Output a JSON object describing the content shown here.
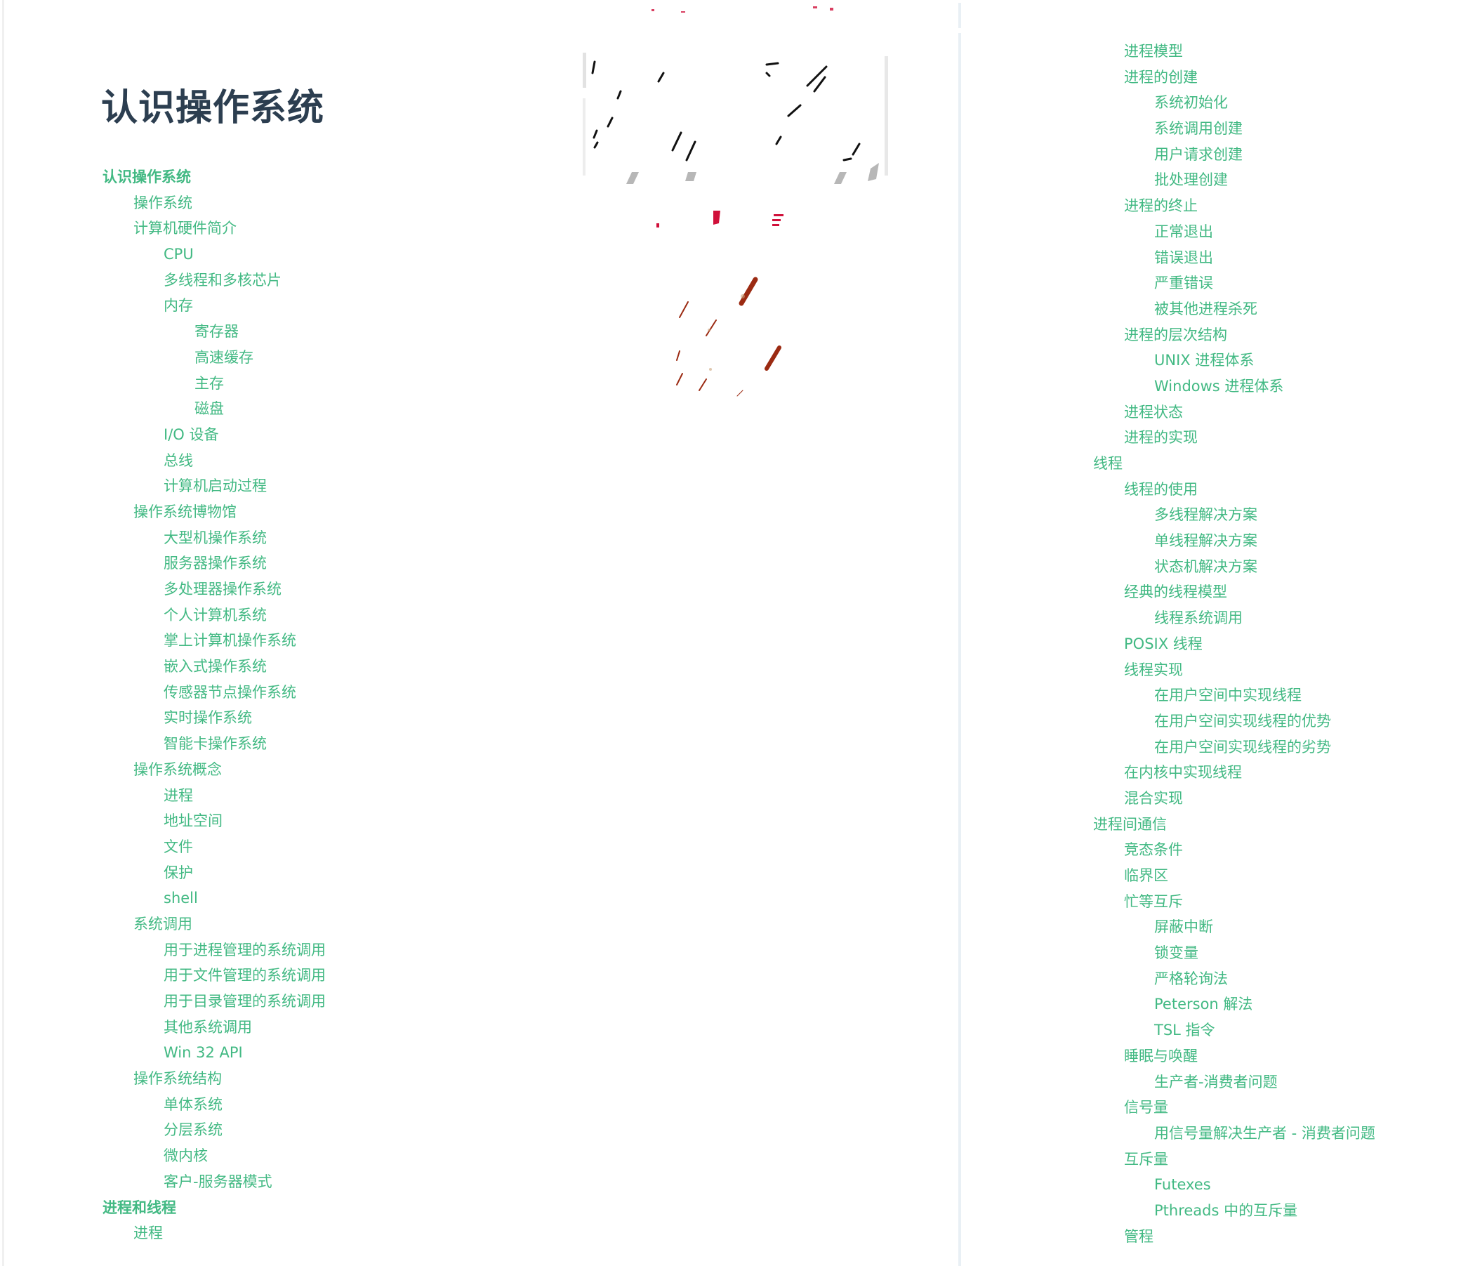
{
  "page": {
    "title": "认识操作系统",
    "link_color": "#42b983",
    "title_color": "#2c3e50"
  },
  "cover_image": {
    "alt": "book cover illustration (faded)"
  },
  "toc_left": [
    {
      "label": "认识操作系统",
      "level": 1,
      "bold": true
    },
    {
      "label": "操作系统",
      "level": 2
    },
    {
      "label": "计算机硬件简介",
      "level": 2
    },
    {
      "label": "CPU",
      "level": 3
    },
    {
      "label": "多线程和多核芯片",
      "level": 3
    },
    {
      "label": "内存",
      "level": 3
    },
    {
      "label": "寄存器",
      "level": 4
    },
    {
      "label": "高速缓存",
      "level": 4
    },
    {
      "label": "主存",
      "level": 4
    },
    {
      "label": "磁盘",
      "level": 4
    },
    {
      "label": "I/O 设备",
      "level": 3
    },
    {
      "label": "总线",
      "level": 3
    },
    {
      "label": "计算机启动过程",
      "level": 3
    },
    {
      "label": "操作系统博物馆",
      "level": 2
    },
    {
      "label": "大型机操作系统",
      "level": 3
    },
    {
      "label": "服务器操作系统",
      "level": 3
    },
    {
      "label": "多处理器操作系统",
      "level": 3
    },
    {
      "label": "个人计算机系统",
      "level": 3
    },
    {
      "label": "掌上计算机操作系统",
      "level": 3
    },
    {
      "label": "嵌入式操作系统",
      "level": 3
    },
    {
      "label": "传感器节点操作系统",
      "level": 3
    },
    {
      "label": "实时操作系统",
      "level": 3
    },
    {
      "label": "智能卡操作系统",
      "level": 3
    },
    {
      "label": "操作系统概念",
      "level": 2
    },
    {
      "label": "进程",
      "level": 3
    },
    {
      "label": "地址空间",
      "level": 3
    },
    {
      "label": "文件",
      "level": 3
    },
    {
      "label": "保护",
      "level": 3
    },
    {
      "label": "shell",
      "level": 3
    },
    {
      "label": "系统调用",
      "level": 2
    },
    {
      "label": "用于进程管理的系统调用",
      "level": 3
    },
    {
      "label": "用于文件管理的系统调用",
      "level": 3
    },
    {
      "label": "用于目录管理的系统调用",
      "level": 3
    },
    {
      "label": "其他系统调用",
      "level": 3
    },
    {
      "label": "Win 32 API",
      "level": 3
    },
    {
      "label": "操作系统结构",
      "level": 2
    },
    {
      "label": "单体系统",
      "level": 3
    },
    {
      "label": "分层系统",
      "level": 3
    },
    {
      "label": "微内核",
      "level": 3
    },
    {
      "label": "客户-服务器模式",
      "level": 3
    },
    {
      "label": "进程和线程",
      "level": 1,
      "bold": true
    },
    {
      "label": "进程",
      "level": 2
    }
  ],
  "toc_right": [
    {
      "label": "进程模型",
      "level": 2
    },
    {
      "label": "进程的创建",
      "level": 2
    },
    {
      "label": "系统初始化",
      "level": 3
    },
    {
      "label": "系统调用创建",
      "level": 3
    },
    {
      "label": "用户请求创建",
      "level": 3
    },
    {
      "label": "批处理创建",
      "level": 3
    },
    {
      "label": "进程的终止",
      "level": 2
    },
    {
      "label": "正常退出",
      "level": 3
    },
    {
      "label": "错误退出",
      "level": 3
    },
    {
      "label": "严重错误",
      "level": 3
    },
    {
      "label": "被其他进程杀死",
      "level": 3
    },
    {
      "label": "进程的层次结构",
      "level": 2
    },
    {
      "label": "UNIX 进程体系",
      "level": 3
    },
    {
      "label": "Windows 进程体系",
      "level": 3
    },
    {
      "label": "进程状态",
      "level": 2
    },
    {
      "label": "进程的实现",
      "level": 2
    },
    {
      "label": "线程",
      "level": 1
    },
    {
      "label": "线程的使用",
      "level": 2
    },
    {
      "label": "多线程解决方案",
      "level": 3
    },
    {
      "label": "单线程解决方案",
      "level": 3
    },
    {
      "label": "状态机解决方案",
      "level": 3
    },
    {
      "label": "经典的线程模型",
      "level": 2
    },
    {
      "label": "线程系统调用",
      "level": 3
    },
    {
      "label": "POSIX 线程",
      "level": 2
    },
    {
      "label": "线程实现",
      "level": 2
    },
    {
      "label": "在用户空间中实现线程",
      "level": 3
    },
    {
      "label": "在用户空间实现线程的优势",
      "level": 3
    },
    {
      "label": "在用户空间实现线程的劣势",
      "level": 3
    },
    {
      "label": "在内核中实现线程",
      "level": 2
    },
    {
      "label": "混合实现",
      "level": 2
    },
    {
      "label": "进程间通信",
      "level": 1
    },
    {
      "label": "竞态条件",
      "level": 2
    },
    {
      "label": "临界区",
      "level": 2
    },
    {
      "label": "忙等互斥",
      "level": 2
    },
    {
      "label": "屏蔽中断",
      "level": 3
    },
    {
      "label": "锁变量",
      "level": 3
    },
    {
      "label": "严格轮询法",
      "level": 3
    },
    {
      "label": "Peterson 解法",
      "level": 3
    },
    {
      "label": "TSL 指令",
      "level": 3
    },
    {
      "label": "睡眠与唤醒",
      "level": 2
    },
    {
      "label": "生产者-消费者问题",
      "level": 3
    },
    {
      "label": "信号量",
      "level": 2
    },
    {
      "label": "用信号量解决生产者 - 消费者问题",
      "level": 3
    },
    {
      "label": "互斥量",
      "level": 2
    },
    {
      "label": "Futexes",
      "level": 3
    },
    {
      "label": "Pthreads 中的互斥量",
      "level": 3
    },
    {
      "label": "管程",
      "level": 2
    }
  ]
}
